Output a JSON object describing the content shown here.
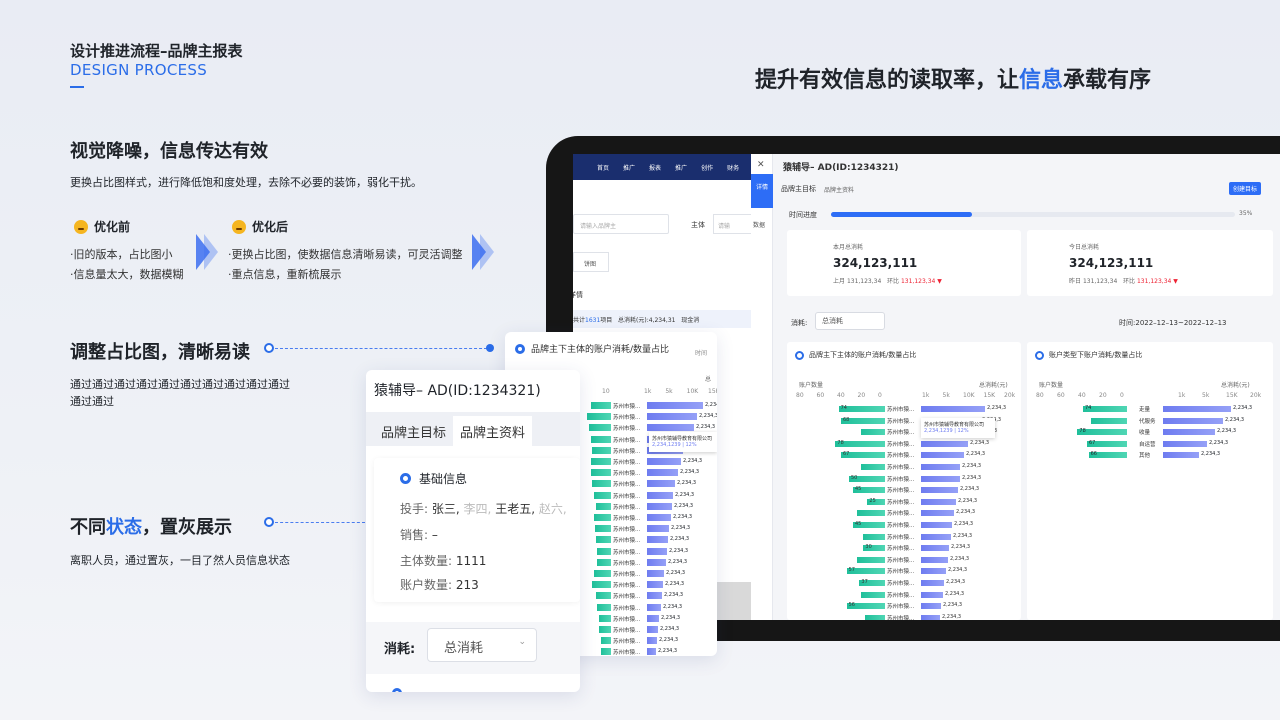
{
  "header": {
    "title": "设计推进流程–品牌主报表",
    "subtitle": "DESIGN PROCESS"
  },
  "slogan": {
    "a": "提升有效信息的读取率，让",
    "b": "信息",
    "c": "承载有序"
  },
  "sec1": {
    "title": "视觉降噪，信息传达有效",
    "desc": "更换占比图样式，进行降低饱和度处理，去除不必要的装饰，弱化干扰。",
    "before_label": "优化前",
    "before_items": [
      "·旧的版本，占比图小",
      "·信息量太大，数据模糊"
    ],
    "after_label": "优化后",
    "after_items": [
      "·更换占比图，使数据信息清晰易读，可灵活调整",
      "·重点信息，重新梳展示"
    ]
  },
  "sec2": {
    "title": "调整占比图，清晰易读",
    "desc1": "通过通过通过通过通过通过通过通过通过通过",
    "desc2": "通过通过"
  },
  "sec3": {
    "title_a": "不同",
    "title_b": "状态",
    "title_c": "，置灰展示",
    "desc": "离职人员，通过置灰，一目了然人员信息状态"
  },
  "colors": {
    "accent": "#2b6de8",
    "nav": "#1a2e6e",
    "green": "#1fbf9a",
    "purple": "#6e7cf0"
  },
  "old": {
    "nav": [
      "首页",
      "推广",
      "报表",
      "推广",
      "创作",
      "财务"
    ],
    "search_ph": "请输入品牌主",
    "subject": "主体",
    "subject_ph": "请输",
    "tab": "饼图",
    "detail": "详情",
    "total": "共计",
    "count": "1631",
    "unit": "项目",
    "spend": "总消耗(元):4,234,31",
    "cash": "现金消"
  },
  "panel": {
    "title": "猿辅导– AD(ID:1234321)",
    "tabs": [
      "品牌主目标",
      "品牌主资料"
    ],
    "create": "创建目标",
    "progress_label": "时间进度",
    "progress_pct": "35%",
    "progress_value": 0.35,
    "side_a": "详情",
    "side_b": "数据",
    "kpi": [
      {
        "label": "本月总消耗",
        "value": "324,123,111",
        "prev_label": "上月",
        "prev": "131,123,34",
        "ratio_label": "环比",
        "ratio": "131,123,34"
      },
      {
        "label": "今日总消耗",
        "value": "324,123,111",
        "prev_label": "昨日",
        "prev": "131,123,34",
        "ratio_label": "环比",
        "ratio": "131,123,34"
      }
    ],
    "spend_label": "消耗:",
    "spend_select": "总消耗",
    "time_label": "时间:",
    "time": "2022–12–13~2022–12–13",
    "chart1": {
      "title": "品牌主下主体的账户消耗/数量占比",
      "left": "账户数量",
      "right": "总消耗(元)",
      "lticks": [
        "80",
        "60",
        "40",
        "20",
        "0"
      ],
      "rticks": [
        "1k",
        "5k",
        "10K",
        "15K",
        "20k"
      ],
      "name": "苏州市猿...",
      "val": "2,234,3",
      "tip_name": "苏州市猿辅导教育有限公司",
      "tip_val": "2,234,1239 | 12%",
      "counts": [
        74,
        68,
        "",
        78,
        67,
        "",
        50,
        45,
        25,
        "",
        45,
        "",
        30,
        "",
        57,
        37,
        "",
        56,
        "",
        17,
        "",
        22,
        "",
        57,
        52
      ],
      "greens": [
        0.58,
        0.55,
        0.3,
        0.62,
        0.55,
        0.3,
        0.45,
        0.4,
        0.22,
        0.35,
        0.4,
        0.28,
        0.27,
        0.35,
        0.48,
        0.32,
        0.3,
        0.48,
        0.25,
        0.15,
        0.2,
        0.2,
        0.18,
        0.48,
        0.44
      ],
      "purples": [
        0.82,
        0.75,
        0.7,
        0.6,
        0.55,
        0.5,
        0.5,
        0.48,
        0.45,
        0.42,
        0.4,
        0.38,
        0.36,
        0.34,
        0.32,
        0.3,
        0.28,
        0.26,
        0.24,
        0.2,
        0.18,
        0.16,
        0.14,
        0.12,
        0.1
      ]
    },
    "chart2": {
      "title": "账户类型下账户消耗/数量占比",
      "left": "账户数量",
      "right": "总消耗(元)",
      "lticks": [
        "80",
        "60",
        "40",
        "20",
        "0"
      ],
      "rticks": [
        "1k",
        "5k",
        "15K",
        "20k"
      ],
      "cats": [
        "走量",
        "代服务",
        "收量",
        "自运营",
        "其他"
      ],
      "counts": [
        74,
        "",
        78,
        67,
        66
      ],
      "val": "2,234,3",
      "greens": [
        0.55,
        0.45,
        0.62,
        0.5,
        0.48
      ],
      "purples": [
        0.85,
        0.75,
        0.65,
        0.55,
        0.45
      ]
    }
  },
  "mid": {
    "title": "品牌主下主体的账户消耗/数量占比",
    "lticks": [
      "20",
      "10"
    ],
    "rticks": [
      "1k",
      "5k",
      "10K",
      "15K"
    ],
    "name": "苏州市猿...",
    "val": "2,234,3",
    "tip_name": "苏州市猿辅导教育有限公司",
    "tip_val": "2,234,1239 | 12%",
    "time_label": "时间",
    "dates": [
      "2022-12-0",
      "2022-12-0",
      "2022-12-0",
      "2022-12-0"
    ],
    "total_label": "总",
    "greens": [
      0.6,
      0.7,
      0.65,
      0.6,
      0.55,
      0.6,
      0.58,
      0.55,
      0.5,
      0.45,
      0.5,
      0.48,
      0.45,
      0.42,
      0.4,
      0.5,
      0.55,
      0.45,
      0.42,
      0.35,
      0.35,
      0.3,
      0.28
    ],
    "purples": [
      0.9,
      0.8,
      0.75,
      0.6,
      0.58,
      0.55,
      0.5,
      0.45,
      0.42,
      0.4,
      0.38,
      0.36,
      0.34,
      0.32,
      0.3,
      0.28,
      0.26,
      0.24,
      0.22,
      0.2,
      0.18,
      0.16,
      0.14
    ]
  },
  "front": {
    "title": "猿辅导– AD(ID:1234321)",
    "tabs": [
      "品牌主目标",
      "品牌主资料"
    ],
    "section": "基础信息",
    "row1_label": "投手:",
    "people": [
      "张三,",
      "李四,",
      "王老五,",
      "赵六,"
    ],
    "people_gray": [
      false,
      true,
      false,
      true
    ],
    "sales_label": "销售:",
    "sales": "–",
    "subj_label": "主体数量:",
    "subj": "1111",
    "acct_label": "账户数量:",
    "acct": "213",
    "spend_label": "消耗:",
    "spend_select": "总消耗"
  }
}
